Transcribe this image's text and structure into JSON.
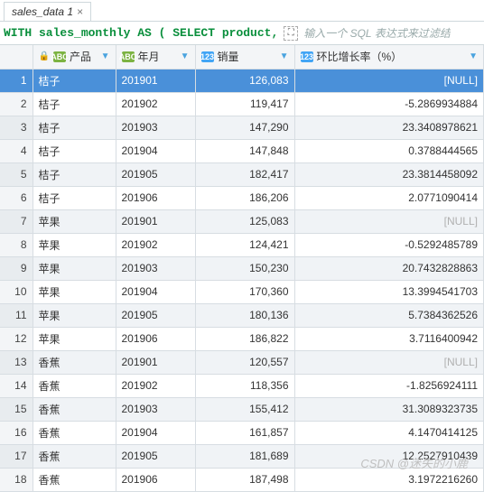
{
  "tab": {
    "title": "sales_data 1",
    "close": "×"
  },
  "filter": {
    "sql": "WITH sales_monthly AS ( SELECT product,",
    "expand_icon": "⛶",
    "hint": "输入一个 SQL 表达式来过滤结"
  },
  "columns": {
    "rownum": "",
    "c1": {
      "icon": "ABC",
      "label": "产品",
      "locked": true
    },
    "c2": {
      "icon": "ABC",
      "label": "年月"
    },
    "c3": {
      "icon": "123",
      "label": "销量"
    },
    "c4": {
      "icon": "123",
      "label": "环比增长率（%）"
    }
  },
  "null_text": "[NULL]",
  "rows": [
    {
      "n": "1",
      "p": "桔子",
      "ym": "201901",
      "s": "126,083",
      "g": null,
      "sel": true
    },
    {
      "n": "2",
      "p": "桔子",
      "ym": "201902",
      "s": "119,417",
      "g": "-5.2869934884"
    },
    {
      "n": "3",
      "p": "桔子",
      "ym": "201903",
      "s": "147,290",
      "g": "23.3408978621",
      "alt": true
    },
    {
      "n": "4",
      "p": "桔子",
      "ym": "201904",
      "s": "147,848",
      "g": "0.3788444565"
    },
    {
      "n": "5",
      "p": "桔子",
      "ym": "201905",
      "s": "182,417",
      "g": "23.3814458092",
      "alt": true
    },
    {
      "n": "6",
      "p": "桔子",
      "ym": "201906",
      "s": "186,206",
      "g": "2.0771090414"
    },
    {
      "n": "7",
      "p": "苹果",
      "ym": "201901",
      "s": "125,083",
      "g": null,
      "alt": true
    },
    {
      "n": "8",
      "p": "苹果",
      "ym": "201902",
      "s": "124,421",
      "g": "-0.5292485789"
    },
    {
      "n": "9",
      "p": "苹果",
      "ym": "201903",
      "s": "150,230",
      "g": "20.7432828863",
      "alt": true
    },
    {
      "n": "10",
      "p": "苹果",
      "ym": "201904",
      "s": "170,360",
      "g": "13.3994541703"
    },
    {
      "n": "11",
      "p": "苹果",
      "ym": "201905",
      "s": "180,136",
      "g": "5.7384362526",
      "alt": true
    },
    {
      "n": "12",
      "p": "苹果",
      "ym": "201906",
      "s": "186,822",
      "g": "3.7116400942"
    },
    {
      "n": "13",
      "p": "香蕉",
      "ym": "201901",
      "s": "120,557",
      "g": null,
      "alt": true
    },
    {
      "n": "14",
      "p": "香蕉",
      "ym": "201902",
      "s": "118,356",
      "g": "-1.8256924111"
    },
    {
      "n": "15",
      "p": "香蕉",
      "ym": "201903",
      "s": "155,412",
      "g": "31.3089323735",
      "alt": true
    },
    {
      "n": "16",
      "p": "香蕉",
      "ym": "201904",
      "s": "161,857",
      "g": "4.1470414125"
    },
    {
      "n": "17",
      "p": "香蕉",
      "ym": "201905",
      "s": "181,689",
      "g": "12.2527910439",
      "alt": true
    },
    {
      "n": "18",
      "p": "香蕉",
      "ym": "201906",
      "s": "187,498",
      "g": "3.1972216260"
    }
  ],
  "watermark": "CSDN @迷失的小鹿"
}
